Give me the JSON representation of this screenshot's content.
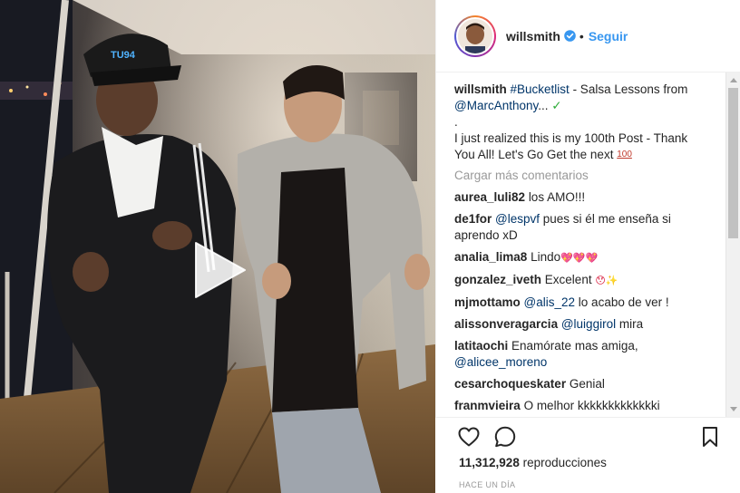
{
  "post": {
    "author": "willsmith",
    "follow_label": "Seguir",
    "separator": "•",
    "caption": {
      "username": "willsmith",
      "hashtag": "#Bucketlist",
      "text_part1": " - Salsa Lessons from ",
      "mention": "@MarcAnthony",
      "ellipsis": "...",
      "check": "✓",
      "dot_line": ".",
      "text_part2": "I just realized this is my 100th Post - Thank You All! Let's Go Get the next ",
      "hundred_emoji": "100"
    },
    "load_more": "Cargar más comentarios",
    "comments": [
      {
        "user": "aurea_luli82",
        "text": "los AMO!!!"
      },
      {
        "user": "de1for",
        "mention": "@lespvf",
        "text": "pues si él me enseña si aprendo xD"
      },
      {
        "user": "analia_lima8",
        "text": "Lindo",
        "emoji": "💖💖💖"
      },
      {
        "user": "gonzalez_iveth",
        "text": "Excelent",
        "emoji": "😯✨"
      },
      {
        "user": "mjmottamo",
        "mention": "@alis_22",
        "text": "lo acabo de ver !"
      },
      {
        "user": "alissonveragarcia",
        "mention": "@luiggirol",
        "text": "mira"
      },
      {
        "user": "latitaochi",
        "text": "Enamórate mas amiga,",
        "mention_after": "@alicee_moreno"
      },
      {
        "user": "cesarchoqueskater",
        "text": "Genial"
      },
      {
        "user": "franmvieira",
        "text": "O melhor kkkkkkkkkkkkki"
      }
    ],
    "views_count": "11,312,928",
    "views_label": "reproducciones",
    "timestamp": "HACE UN DÍA",
    "video_cap_text": "TU94"
  },
  "colors": {
    "link": "#003569",
    "follow": "#3897f0",
    "muted": "#999999",
    "verified": "#3897f0"
  },
  "icons": [
    "play-icon",
    "verified-badge-icon",
    "heart-icon",
    "comment-icon",
    "bookmark-icon"
  ]
}
